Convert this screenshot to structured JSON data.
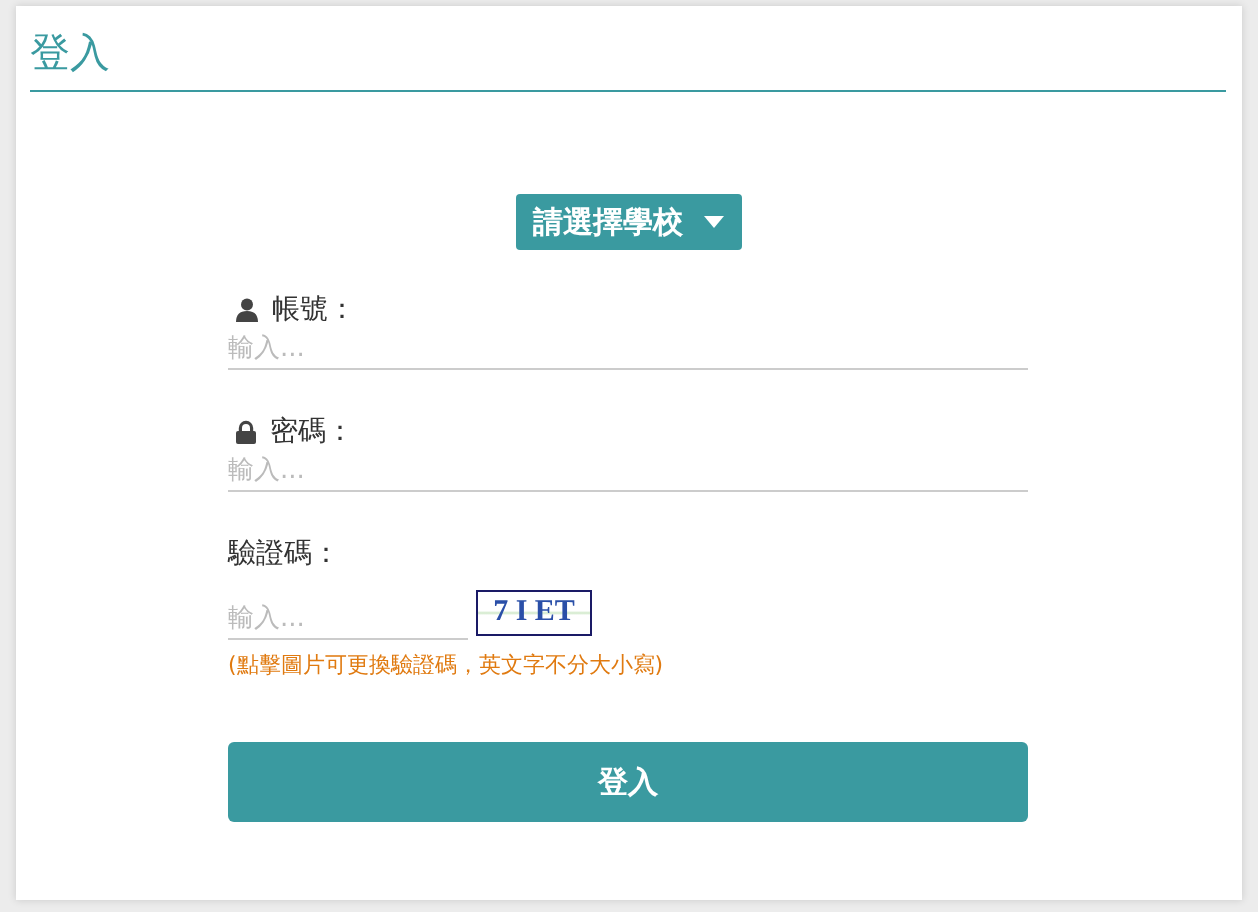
{
  "title": "登入",
  "school_select": {
    "label": "請選擇學校"
  },
  "fields": [
    {
      "kind": "user",
      "label": "帳號：",
      "placeholder": "輸入..."
    },
    {
      "kind": "lock",
      "label": "密碼：",
      "placeholder": "輸入..."
    }
  ],
  "captcha": {
    "label": "驗證碼：",
    "placeholder": "輸入...",
    "code": "7 I ET",
    "hint": "(點擊圖片可更換驗證碼，英文字不分大小寫)"
  },
  "submit": "登入"
}
